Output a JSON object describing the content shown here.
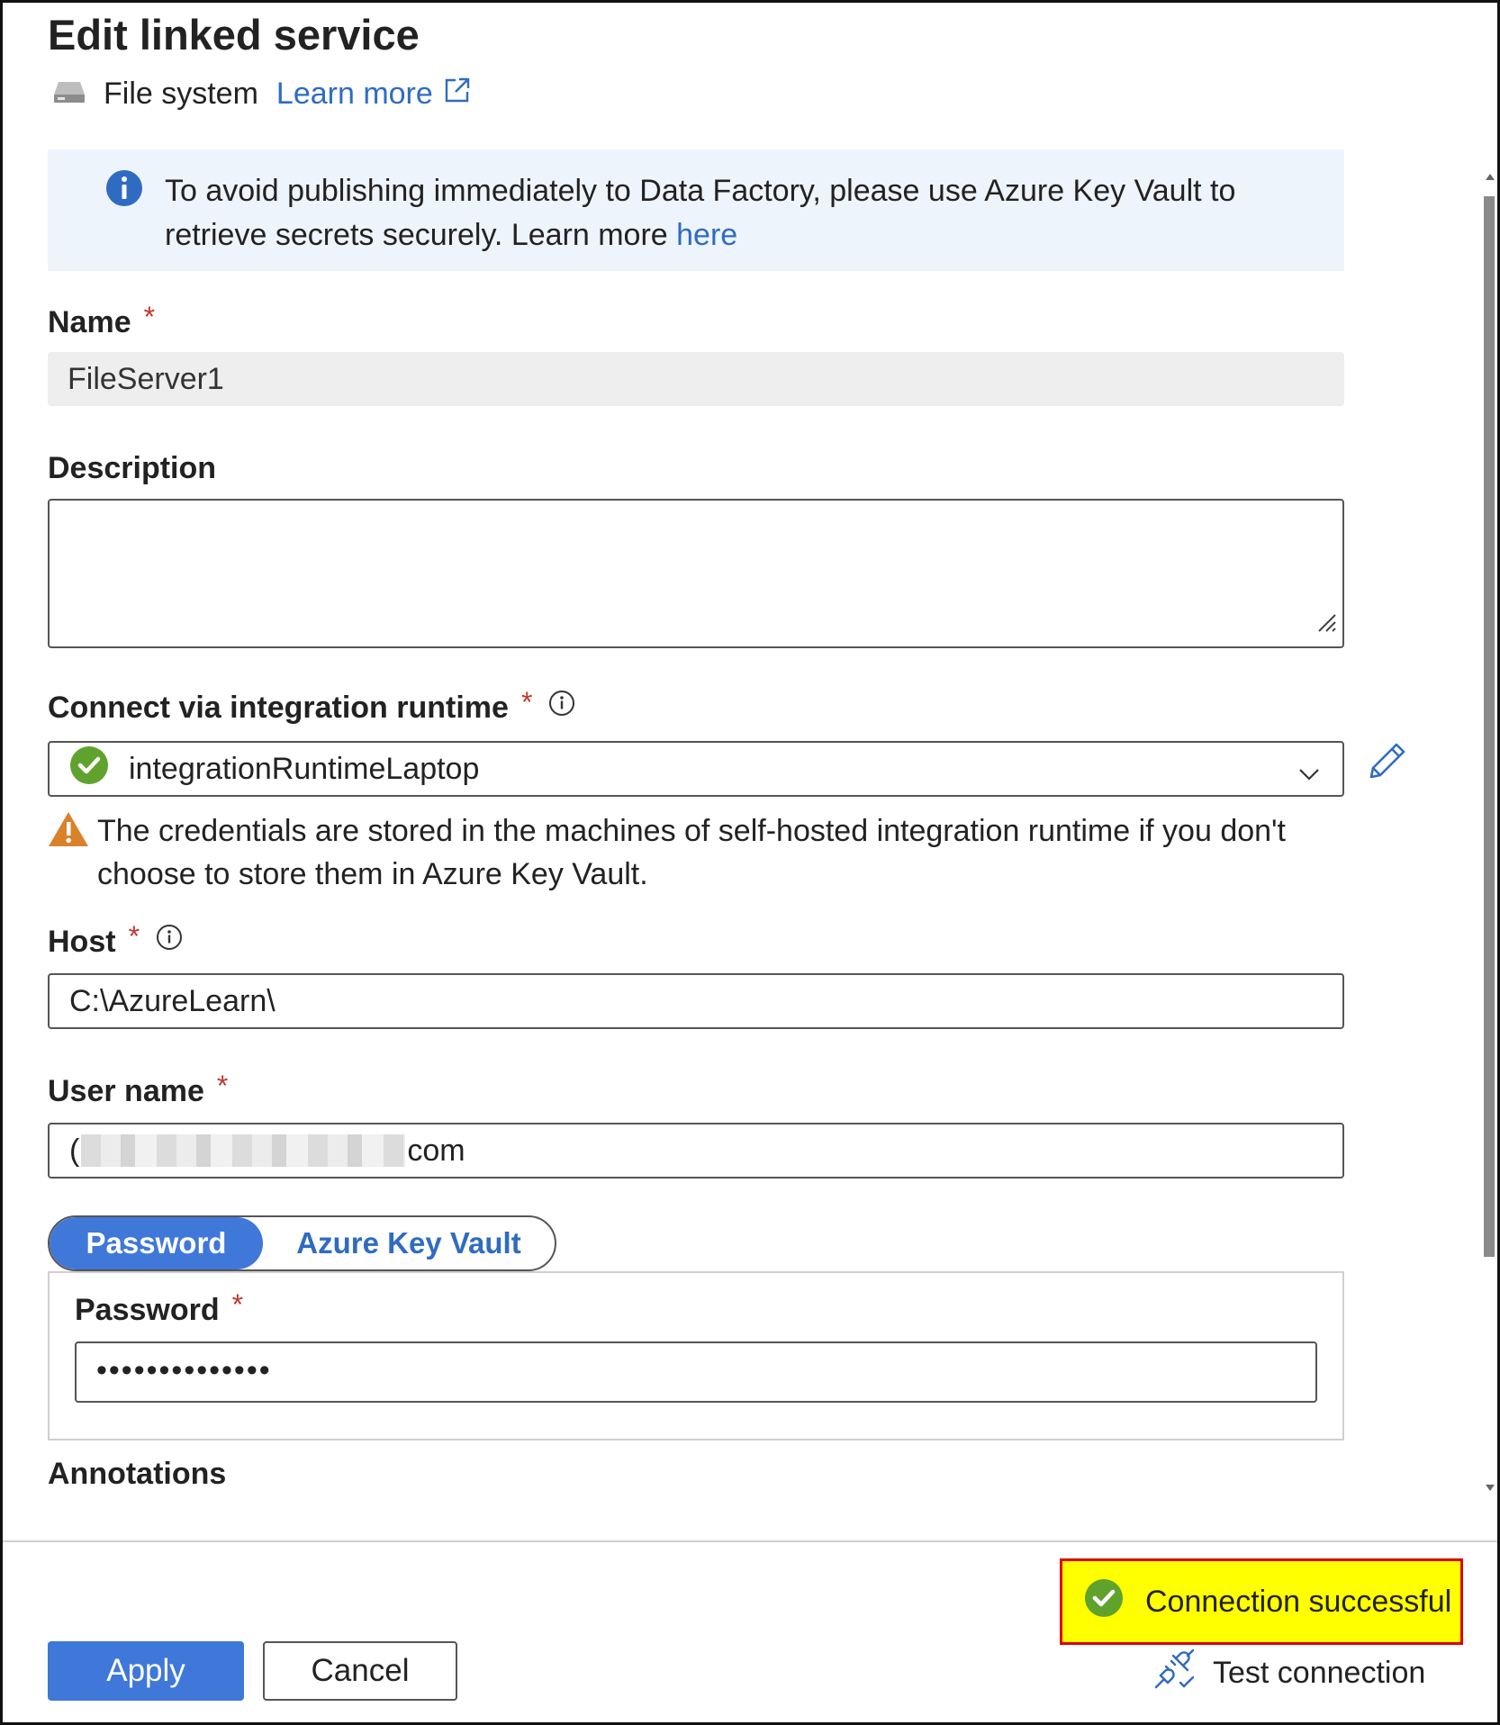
{
  "header": {
    "title": "Edit linked service",
    "service_type": "File system",
    "learn_more": "Learn more"
  },
  "info_banner": {
    "text": "To avoid publishing immediately to Data Factory, please use Azure Key Vault to retrieve secrets securely. Learn more ",
    "link": "here"
  },
  "form": {
    "name": {
      "label": "Name",
      "required": "*",
      "value": "FileServer1"
    },
    "description": {
      "label": "Description",
      "value": ""
    },
    "integration_runtime": {
      "label": "Connect via integration runtime",
      "required": "*",
      "value": "integrationRuntimeLaptop",
      "warning": "The credentials are stored in the machines of self-hosted integration runtime if you don't choose to store them in Azure Key Vault."
    },
    "host": {
      "label": "Host",
      "required": "*",
      "value": "C:\\AzureLearn\\"
    },
    "user_name": {
      "label": "User name",
      "required": "*",
      "value_prefix": "(",
      "value_suffix": "com"
    },
    "auth_toggle": {
      "options": [
        "Password",
        "Azure Key Vault"
      ],
      "selected": "Password"
    },
    "password": {
      "label": "Password",
      "required": "*",
      "value": "••••••••••••••"
    },
    "annotations_label": "Annotations"
  },
  "footer": {
    "status": "Connection successful",
    "apply": "Apply",
    "cancel": "Cancel",
    "test_connection": "Test connection"
  },
  "colors": {
    "accent": "#3f78d8",
    "link": "#2f6cc1",
    "success": "#5fa32e",
    "warning": "#d9822b",
    "highlight": "#ffff00",
    "highlight_border": "#e00000"
  }
}
